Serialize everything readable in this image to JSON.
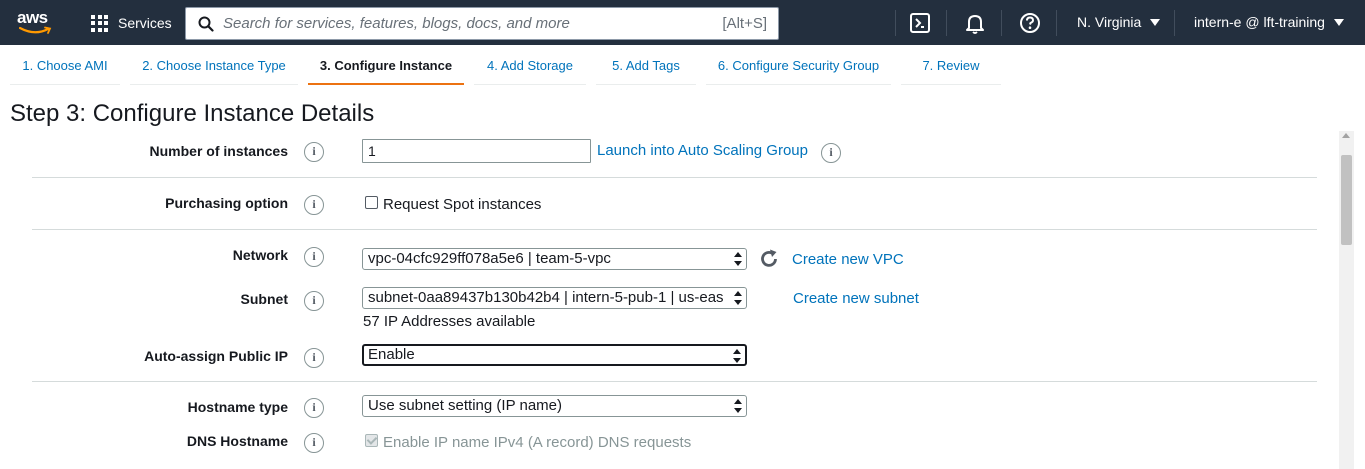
{
  "topnav": {
    "logo_text": "aws",
    "services_label": "Services",
    "search": {
      "placeholder": "Search for services, features, blogs, docs, and more",
      "shortcut": "[Alt+S]"
    },
    "region": "N. Virginia",
    "account": "intern-e @ lft-training",
    "icons": [
      "cloudshell-icon",
      "bell-icon",
      "help-icon"
    ]
  },
  "wizard": {
    "tabs": [
      {
        "label": "1. Choose AMI",
        "active": false
      },
      {
        "label": "2. Choose Instance Type",
        "active": false
      },
      {
        "label": "3. Configure Instance",
        "active": true
      },
      {
        "label": "4. Add Storage",
        "active": false
      },
      {
        "label": "5. Add Tags",
        "active": false
      },
      {
        "label": "6. Configure Security Group",
        "active": false
      },
      {
        "label": "7. Review",
        "active": false
      }
    ],
    "accent_color": "#ec7211"
  },
  "page": {
    "title": "Step 3: Configure Instance Details"
  },
  "form": {
    "number_of_instances": {
      "label": "Number of instances",
      "value": "1",
      "link": "Launch into Auto Scaling Group"
    },
    "purchasing_option": {
      "label": "Purchasing option",
      "checkbox_label": "Request Spot instances",
      "checked": false
    },
    "network": {
      "label": "Network",
      "value": "vpc-04cfc929ff078a5e6 | team-5-vpc",
      "link": "Create new VPC"
    },
    "subnet": {
      "label": "Subnet",
      "value": "subnet-0aa89437b130b42b4 | intern-5-pub-1 | us-eas",
      "link": "Create new subnet",
      "note": "57 IP Addresses available"
    },
    "auto_assign_public_ip": {
      "label": "Auto-assign Public IP",
      "value": "Enable"
    },
    "hostname_type": {
      "label": "Hostname type",
      "value": "Use subnet setting (IP name)"
    },
    "dns_hostname": {
      "label": "DNS Hostname",
      "checkbox_label": "Enable IP name IPv4 (A record) DNS requests",
      "checked": true,
      "disabled": true
    }
  },
  "colors": {
    "nav_bg": "#232f3e",
    "link": "#0073bb",
    "text": "#16191f"
  }
}
